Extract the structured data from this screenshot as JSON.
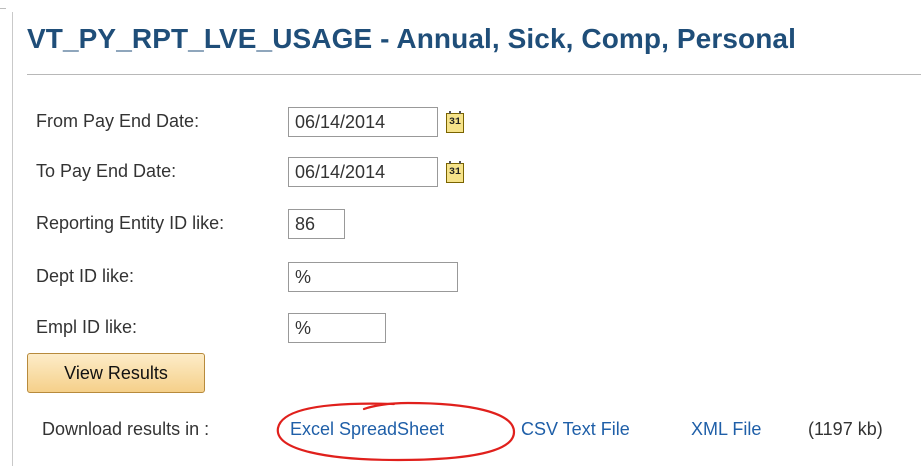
{
  "page": {
    "title": "VT_PY_RPT_LVE_USAGE - Annual, Sick, Comp, Personal"
  },
  "form": {
    "from_date": {
      "label": "From Pay End Date:",
      "value": "06/14/2014",
      "calendar_icon": "calendar-icon",
      "calendar_text": "31"
    },
    "to_date": {
      "label": "To Pay End Date:",
      "value": "06/14/2014",
      "calendar_icon": "calendar-icon",
      "calendar_text": "31"
    },
    "reporting_entity": {
      "label": "Reporting Entity ID like:",
      "value": "86"
    },
    "dept_id": {
      "label": "Dept ID like:",
      "value": "%"
    },
    "empl_id": {
      "label": "Empl ID like:",
      "value": "%"
    }
  },
  "actions": {
    "view_results": "View Results"
  },
  "download": {
    "label": "Download results in :",
    "excel": "Excel SpreadSheet",
    "csv": "CSV Text File",
    "xml": "XML File",
    "size": "(1197 kb)"
  },
  "colors": {
    "title": "#1f4e79",
    "link": "#1f5fa8",
    "annotation_circle": "#e0201c",
    "button_top": "#fdecc8",
    "button_bottom": "#f5d08a"
  }
}
